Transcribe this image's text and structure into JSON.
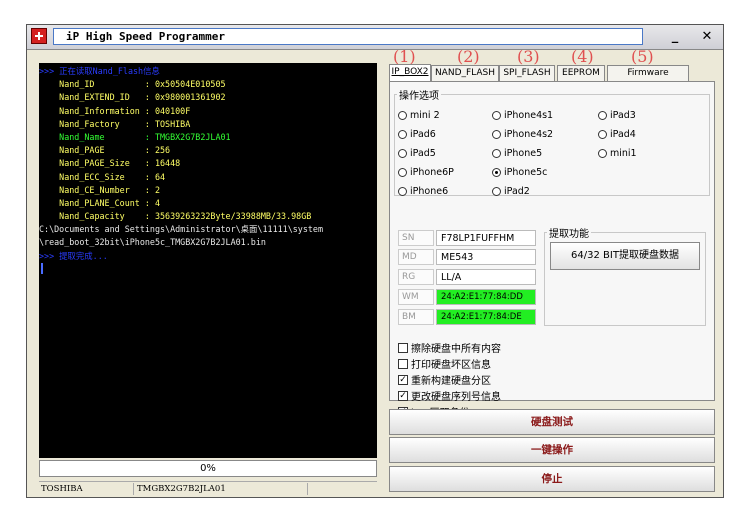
{
  "window": {
    "title": "iP High Speed Programmer",
    "minimize_glyph": "_",
    "close_glyph": "✕"
  },
  "console": {
    "lines": [
      {
        "text": ">>> 正在读取Nand_Flash信息",
        "color": "blue"
      },
      {
        "text": "    Nand_ID          : 0x50504E010505",
        "color": "yellow"
      },
      {
        "text": "    Nand_EXTEND_ID   : 0x980001361902",
        "color": "yellow"
      },
      {
        "text": "    Nand_Information : 040100F",
        "color": "yellow"
      },
      {
        "text": "    Nand_Factory     : TOSHIBA",
        "color": "yellow"
      },
      {
        "text": "    Nand_Name        : TMGBX2G7B2JLA01",
        "color": "yellow"
      },
      {
        "text": "    Nand_PAGE        : 256",
        "color": "yellow"
      },
      {
        "text": "    Nand_PAGE_Size   : 16448",
        "color": "yellow"
      },
      {
        "text": "    Nand_ECC_Size    : 64",
        "color": "yellow"
      },
      {
        "text": "    Nand_CE_Number   : 2",
        "color": "yellow"
      },
      {
        "text": "    Nand_PLANE_Count : 4",
        "color": "yellow"
      },
      {
        "text": "    Nand_Capacity    : 35639263232Byte/33988MB/33.98GB",
        "color": "yellow"
      },
      {
        "text": "C:\\Documents and Settings\\Administrator\\桌面\\11111\\system",
        "color": "white"
      },
      {
        "text": "\\read_boot_32bit\\iPhone5c_TMGBX2G7B2JLA01.bin",
        "color": "white"
      },
      {
        "text": ">>> 提取完成...",
        "color": "blue"
      }
    ]
  },
  "progress": {
    "label": "0%",
    "value": 0
  },
  "statusbar": {
    "vendor": "TOSHIBA",
    "nand_name": "TMGBX2G7B2JLA01"
  },
  "tab_numbers": [
    "(1)",
    "(2)",
    "(3)",
    "(4)",
    "(5)"
  ],
  "tabs": [
    {
      "label": "IP_BOX2",
      "active": true
    },
    {
      "label": "NAND_FLASH",
      "active": false
    },
    {
      "label": "SPI_FLASH",
      "active": false
    },
    {
      "label": "EEPROM",
      "active": false
    },
    {
      "label": "Firmware Upgrade",
      "active": false
    }
  ],
  "options": {
    "title": "操作选项",
    "radios": [
      {
        "label": "mini 2",
        "selected": false
      },
      {
        "label": "iPhone4s1",
        "selected": false
      },
      {
        "label": "iPad3",
        "selected": false
      },
      {
        "label": "iPad6",
        "selected": false
      },
      {
        "label": "iPhone4s2",
        "selected": false
      },
      {
        "label": "iPad4",
        "selected": false
      },
      {
        "label": "iPad5",
        "selected": false
      },
      {
        "label": "iPhone5",
        "selected": false
      },
      {
        "label": "mini1",
        "selected": false
      },
      {
        "label": "iPhone6P",
        "selected": false
      },
      {
        "label": "iPhone5c",
        "selected": true
      },
      {
        "label": "iPhone6",
        "selected": false
      },
      {
        "label": "iPad2",
        "selected": false
      }
    ]
  },
  "fields": [
    {
      "label": "SN",
      "value": "F78LP1FUFFHM",
      "highlight": false
    },
    {
      "label": "MD",
      "value": "ME543",
      "highlight": false
    },
    {
      "label": "RG",
      "value": "LL/A",
      "highlight": false
    },
    {
      "label": "WM",
      "value": "24:A2:E1:77:84:DD",
      "highlight": true
    },
    {
      "label": "BM",
      "value": "24:A2:E1:77:84:DE",
      "highlight": true
    }
  ],
  "fetch": {
    "title": "提取功能",
    "button_label": "64/32 BIT提取硬盘数据"
  },
  "checkboxes": [
    {
      "label": "擦除硬盘中所有内容",
      "checked": false
    },
    {
      "label": "打印硬盘坏区信息",
      "checked": false
    },
    {
      "label": "重新构建硬盘分区",
      "checked": true
    },
    {
      "label": "更改硬盘序列号信息",
      "checked": true
    },
    {
      "label": "boo区双备份",
      "checked": true
    }
  ],
  "actions": {
    "test_label": "硬盘测试",
    "oneclick_label": "一键操作",
    "stop_label": "停止"
  },
  "colors": {
    "console_bg": "#000000",
    "highlight_green": "#22ee22",
    "tab_number": "#e05050"
  }
}
